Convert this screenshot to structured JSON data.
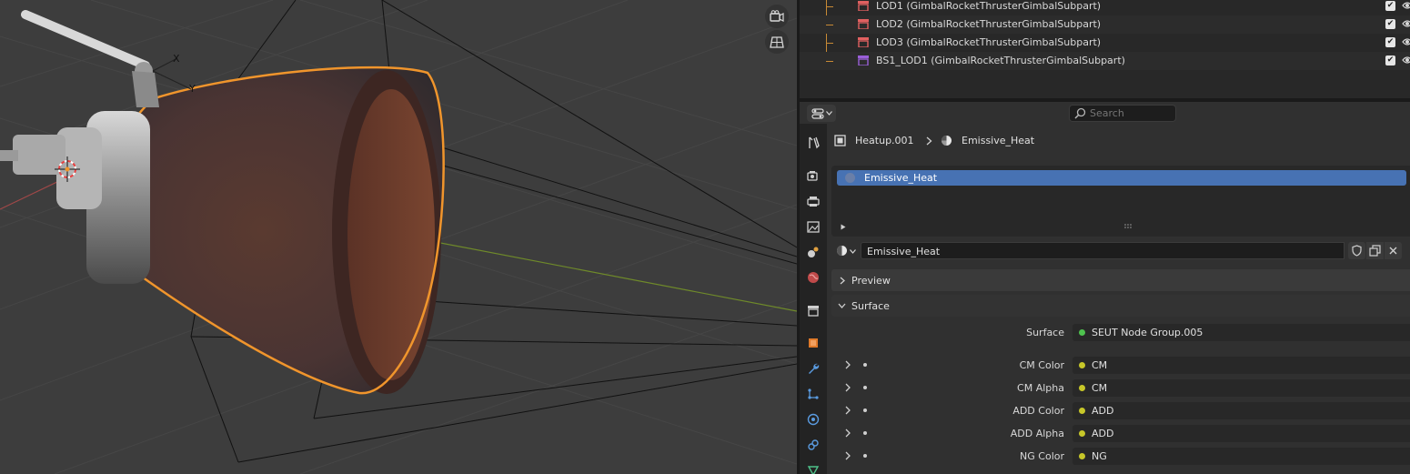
{
  "outliner": {
    "rows": [
      {
        "label": "LOD1 (GimbalRocketThrusterGimbalSubpart)",
        "icon": "collection-icon",
        "color": "#e06060",
        "checked": true
      },
      {
        "label": "LOD2 (GimbalRocketThrusterGimbalSubpart)",
        "icon": "collection-icon",
        "color": "#e06060",
        "checked": true
      },
      {
        "label": "LOD3 (GimbalRocketThrusterGimbalSubpart)",
        "icon": "collection-icon",
        "color": "#e06060",
        "checked": true
      },
      {
        "label": "BS1_LOD1 (GimbalRocketThrusterGimbalSubpart)",
        "icon": "collection-icon",
        "color": "#9a5fd8",
        "checked": true
      }
    ]
  },
  "properties": {
    "search_placeholder": "Search",
    "breadcrumb": {
      "object": "Heatup.001",
      "material": "Emissive_Heat"
    },
    "material_slots": [
      "Emissive_Heat"
    ],
    "material_name": "Emissive_Heat",
    "panels": {
      "preview": "Preview",
      "surface": "Surface"
    },
    "surface": {
      "label": "Surface",
      "value": "SEUT Node Group.005",
      "socket_color": "#4ec24e"
    },
    "inputs": [
      {
        "label": "CM Color",
        "value": "CM",
        "socket_color": "#c7c729"
      },
      {
        "label": "CM Alpha",
        "value": "CM",
        "socket_color": "#c7c729"
      },
      {
        "label": "ADD Color",
        "value": "ADD",
        "socket_color": "#c7c729"
      },
      {
        "label": "ADD Alpha",
        "value": "ADD",
        "socket_color": "#c7c729"
      },
      {
        "label": "NG Color",
        "value": "NG",
        "socket_color": "#c7c729"
      }
    ]
  },
  "viewport": {
    "gizmo_labels": {
      "x": "X",
      "y": "Y"
    },
    "selection_color": "#f0952c"
  }
}
